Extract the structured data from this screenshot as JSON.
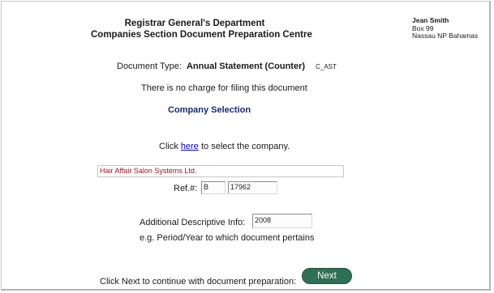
{
  "header": {
    "title_line1": "Registrar General's Department",
    "title_line2": "Companies Section Document Preparation Centre"
  },
  "user": {
    "name": "Jean Smith",
    "address_line1": "Box 99",
    "address_line2": "Nassau NP Bahamas"
  },
  "document": {
    "type_label": "Document Type:",
    "type_value": "Annual Statement (Counter)",
    "type_code": "C_AST",
    "charge_note": "There is no charge for filing this document"
  },
  "company_selection": {
    "heading": "Company Selection",
    "click_prefix": "Click",
    "click_link": "here",
    "click_suffix": "to select the company.",
    "company_name": "Hair Affair Salon Systems Ltd.",
    "ref_label": "Ref.#:",
    "ref_prefix": "B",
    "ref_number": "17962"
  },
  "additional": {
    "label": "Additional Descriptive Info:",
    "value": "2008",
    "hint": "e.g. Period/Year to which document pertains"
  },
  "footer": {
    "continue_text": "Click Next to continue with document preparation:",
    "next_label": "Next"
  },
  "colors": {
    "next_button": "#2f6f57",
    "company_text": "#a0102a",
    "section_heading": "#1a2a6c",
    "link": "#0000cc"
  }
}
